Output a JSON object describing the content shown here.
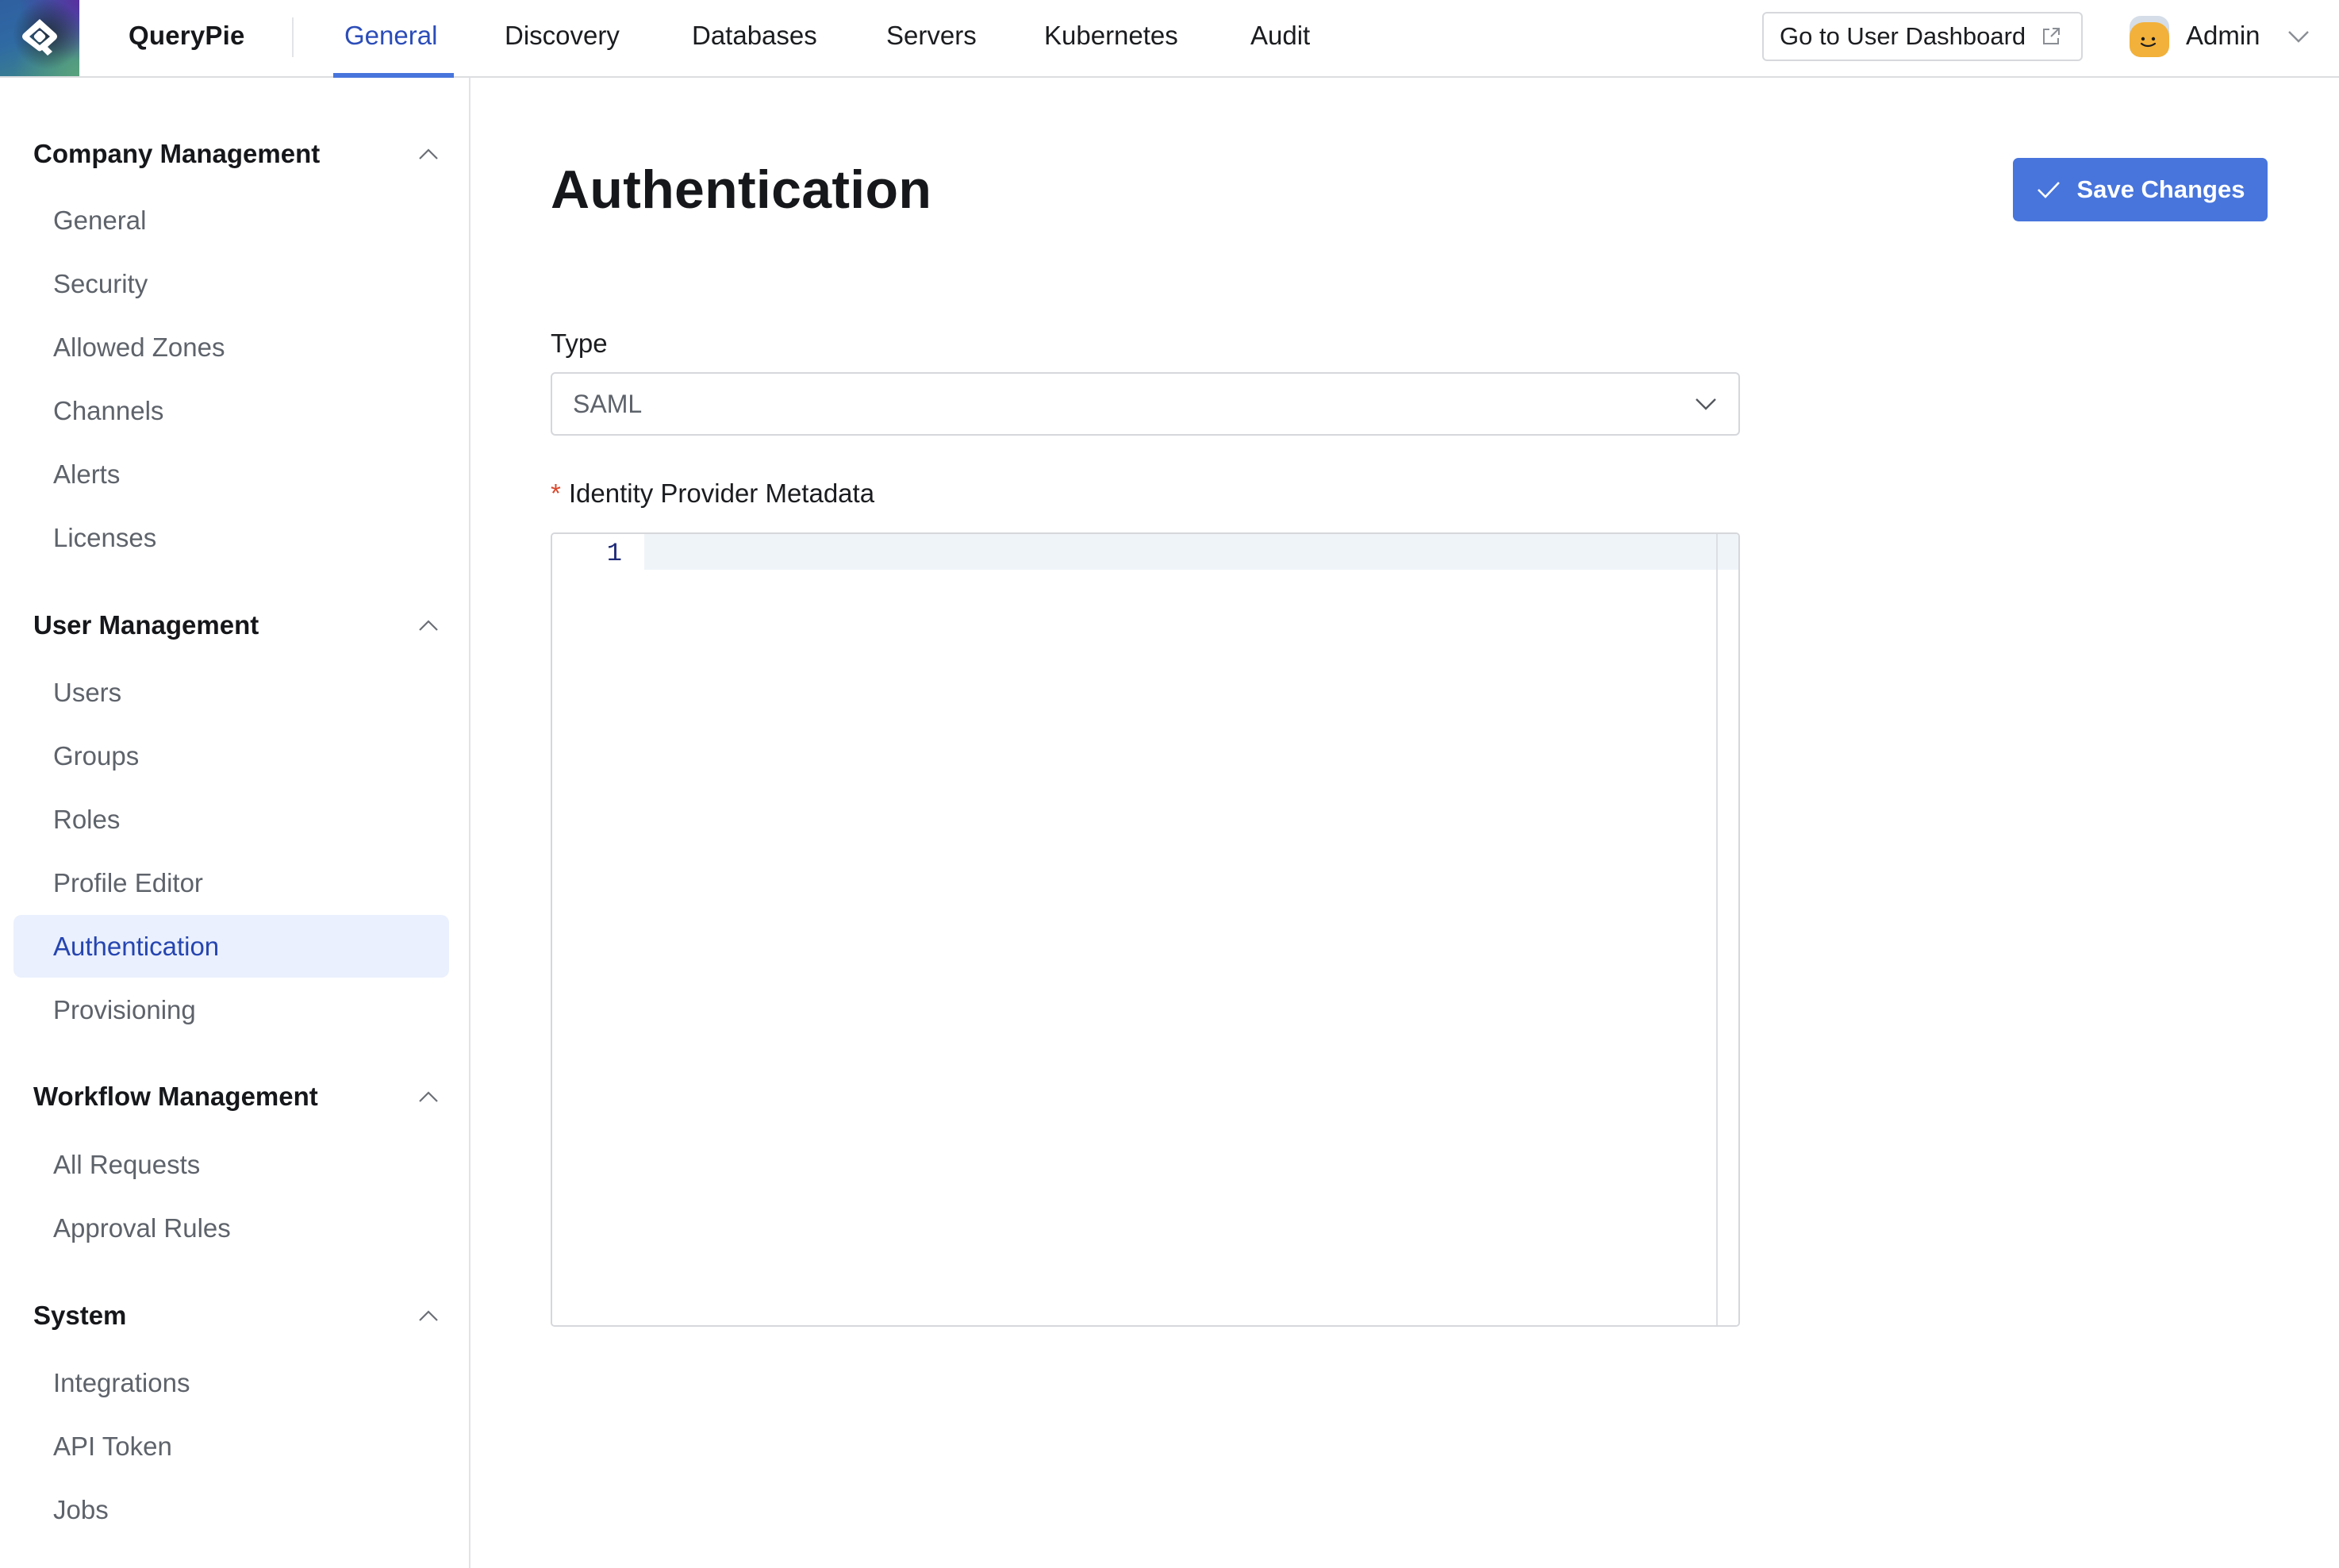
{
  "header": {
    "brand": "QueryPie",
    "logo_icon": "querypie-logo-icon",
    "tabs": [
      {
        "label": "General",
        "active": true
      },
      {
        "label": "Discovery",
        "active": false
      },
      {
        "label": "Databases",
        "active": false
      },
      {
        "label": "Servers",
        "active": false
      },
      {
        "label": "Kubernetes",
        "active": false
      },
      {
        "label": "Audit",
        "active": false
      }
    ],
    "dashboard_button": {
      "label": "Go to User Dashboard",
      "icon": "external-link-icon"
    },
    "user": {
      "name": "Admin",
      "avatar_icon": "smiley-avatar-icon",
      "menu_icon": "chevron-down-icon"
    }
  },
  "sidebar": {
    "sections": [
      {
        "title": "Company Management",
        "expanded": true,
        "items": [
          "General",
          "Security",
          "Allowed Zones",
          "Channels",
          "Alerts",
          "Licenses"
        ]
      },
      {
        "title": "User Management",
        "expanded": true,
        "items": [
          "Users",
          "Groups",
          "Roles",
          "Profile Editor",
          "Authentication",
          "Provisioning"
        ]
      },
      {
        "title": "Workflow Management",
        "expanded": true,
        "items": [
          "All Requests",
          "Approval Rules"
        ]
      },
      {
        "title": "System",
        "expanded": true,
        "items": [
          "Integrations",
          "API Token",
          "Jobs"
        ]
      }
    ],
    "active_item": "Authentication"
  },
  "main": {
    "title": "Authentication",
    "save_button": {
      "label": "Save Changes",
      "icon": "check-icon"
    },
    "type_field": {
      "label": "Type",
      "value": "SAML"
    },
    "metadata_field": {
      "label": "Identity Provider Metadata",
      "required": true,
      "required_mark": "*",
      "value": "",
      "line_numbers": [
        "1"
      ]
    }
  },
  "colors": {
    "accent": "#4875dc",
    "active_text": "#2545b0",
    "active_bg": "#eaf0fd",
    "required": "#d9472b"
  }
}
